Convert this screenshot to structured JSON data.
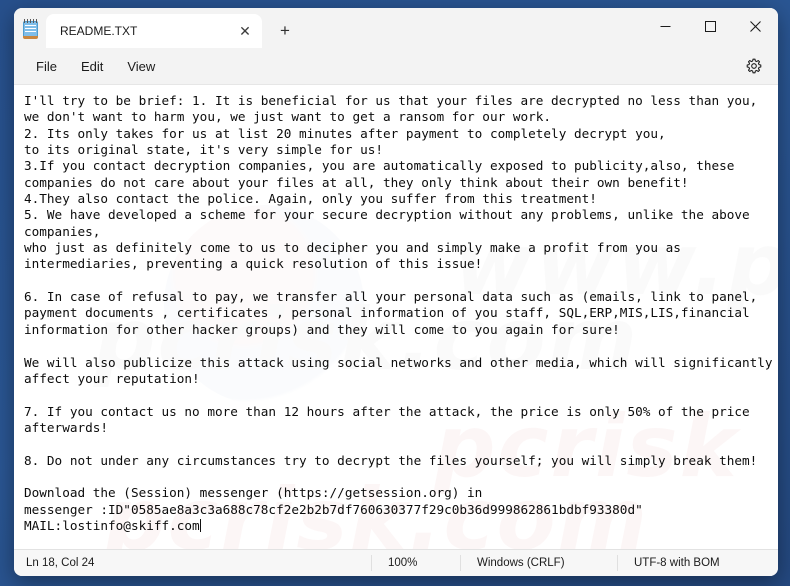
{
  "window": {
    "app_icon": "notepad-icon",
    "controls": {
      "minimize": "minimize-icon",
      "maximize": "maximize-icon",
      "close": "close-icon"
    }
  },
  "tabs": [
    {
      "label": "README.TXT",
      "close_label": "✕",
      "active": true
    }
  ],
  "new_tab_label": "+",
  "menu": {
    "items": [
      {
        "label": "File"
      },
      {
        "label": "Edit"
      },
      {
        "label": "View"
      }
    ],
    "settings_icon": "gear-icon"
  },
  "editor": {
    "content": "I'll try to be brief: 1. It is beneficial for us that your files are decrypted no less than you,\nwe don't want to harm you, we just want to get a ransom for our work.\n2. Its only takes for us at list 20 minutes after payment to completely decrypt you,\nto its original state, it's very simple for us!\n3.If you contact decryption companies, you are automatically exposed to publicity,also, these\ncompanies do not care about your files at all, they only think about their own benefit!\n4.They also contact the police. Again, only you suffer from this treatment!\n5. We have developed a scheme for your secure decryption without any problems, unlike the above\ncompanies,\nwho just as definitely come to us to decipher you and simply make a profit from you as\nintermediaries, preventing a quick resolution of this issue!\n\n6. In case of refusal to pay, we transfer all your personal data such as (emails, link to panel,\npayment documents , certificates , personal information of you staff, SQL,ERP,MIS,LIS,financial\ninformation for other hacker groups) and they will come to you again for sure!\n\nWe will also publicize this attack using social networks and other media, which will significantly\naffect your reputation!\n\n7. If you contact us no more than 12 hours after the attack, the price is only 50% of the price\nafterwards!\n\n8. Do not under any circumstances try to decrypt the files yourself; you will simply break them!\n\nDownload the (Session) messenger (https://getsession.org) in\nmessenger :ID\"0585ae8a3c3a688c78cf2e2b2b7df760630377f29c0b36d999862861bdbf93380d\"\nMAIL:lostinfo@skiff.com"
  },
  "watermark": {
    "line1": "www.pcrisk",
    "line2": "pcrisk.com",
    "line3": "pcrisk",
    "line4": "pcrisk.com"
  },
  "statusbar": {
    "cursor": "Ln 18, Col 24",
    "zoom": "100%",
    "line_ending": "Windows (CRLF)",
    "encoding": "UTF-8 with BOM"
  },
  "colors": {
    "desktop": "#2a5490",
    "window_chrome": "#f3f3f3",
    "editor_bg": "#ffffff",
    "text": "#0c0c0c"
  }
}
